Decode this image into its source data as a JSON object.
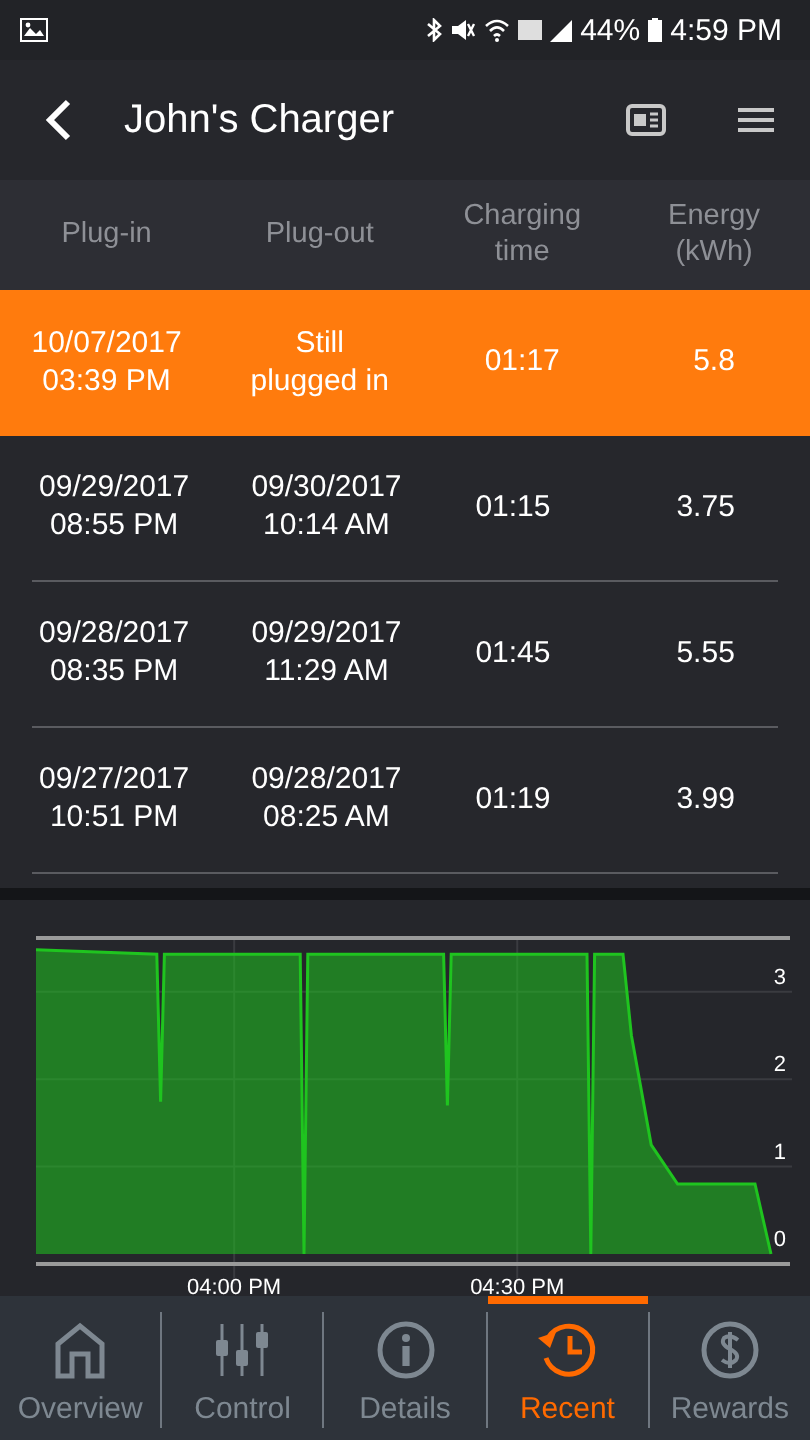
{
  "status_bar": {
    "battery": "44%",
    "time": "4:59 PM"
  },
  "header": {
    "title": "John's Charger"
  },
  "table": {
    "columns": [
      "Plug-in",
      "Plug-out",
      "Charging\ntime",
      "Energy\n(kWh)"
    ],
    "rows": [
      {
        "selected": true,
        "cells": [
          "10/07/2017\n03:39 PM",
          "Still\nplugged in",
          "01:17",
          "5.8"
        ]
      },
      {
        "selected": false,
        "cells": [
          "09/29/2017\n08:55 PM",
          "09/30/2017\n10:14 AM",
          "01:15",
          "3.75"
        ]
      },
      {
        "selected": false,
        "cells": [
          "09/28/2017\n08:35 PM",
          "09/29/2017\n11:29 AM",
          "01:45",
          "5.55"
        ]
      },
      {
        "selected": false,
        "cells": [
          "09/27/2017\n10:51 PM",
          "09/28/2017\n08:25 AM",
          "01:19",
          "3.99"
        ]
      }
    ]
  },
  "chart": {
    "chart_data": {
      "type": "area",
      "xlim": [
        939,
        1017
      ],
      "ylim": [
        0,
        3.5
      ],
      "grid": true,
      "xticks": [
        {
          "value": 960,
          "label": "04:00 PM"
        },
        {
          "value": 990,
          "label": "04:30 PM"
        }
      ],
      "yticks": [
        0,
        1,
        2,
        3
      ],
      "series": [
        {
          "color": "#1fc41f",
          "x": [
            939,
            951.8,
            952.2,
            952.6,
            967,
            967.4,
            967.8,
            982.2,
            982.6,
            983,
            997.4,
            997.8,
            998.2,
            1001.2,
            1002.1,
            1004.2,
            1007,
            1015.2,
            1016.9
          ],
          "values": [
            3.48,
            3.43,
            1.74,
            3.43,
            3.43,
            0,
            3.43,
            3.43,
            1.7,
            3.43,
            3.43,
            0,
            3.43,
            3.43,
            2.5,
            1.25,
            0.8,
            0.8,
            0
          ]
        }
      ]
    }
  },
  "nav": [
    {
      "kind": "home",
      "label": "Overview",
      "selected": false
    },
    {
      "kind": "sliders",
      "label": "Control",
      "selected": false
    },
    {
      "kind": "info",
      "label": "Details",
      "selected": false
    },
    {
      "kind": "history",
      "label": "Recent",
      "selected": true
    },
    {
      "kind": "dollar",
      "label": "Rewards",
      "selected": false
    }
  ]
}
